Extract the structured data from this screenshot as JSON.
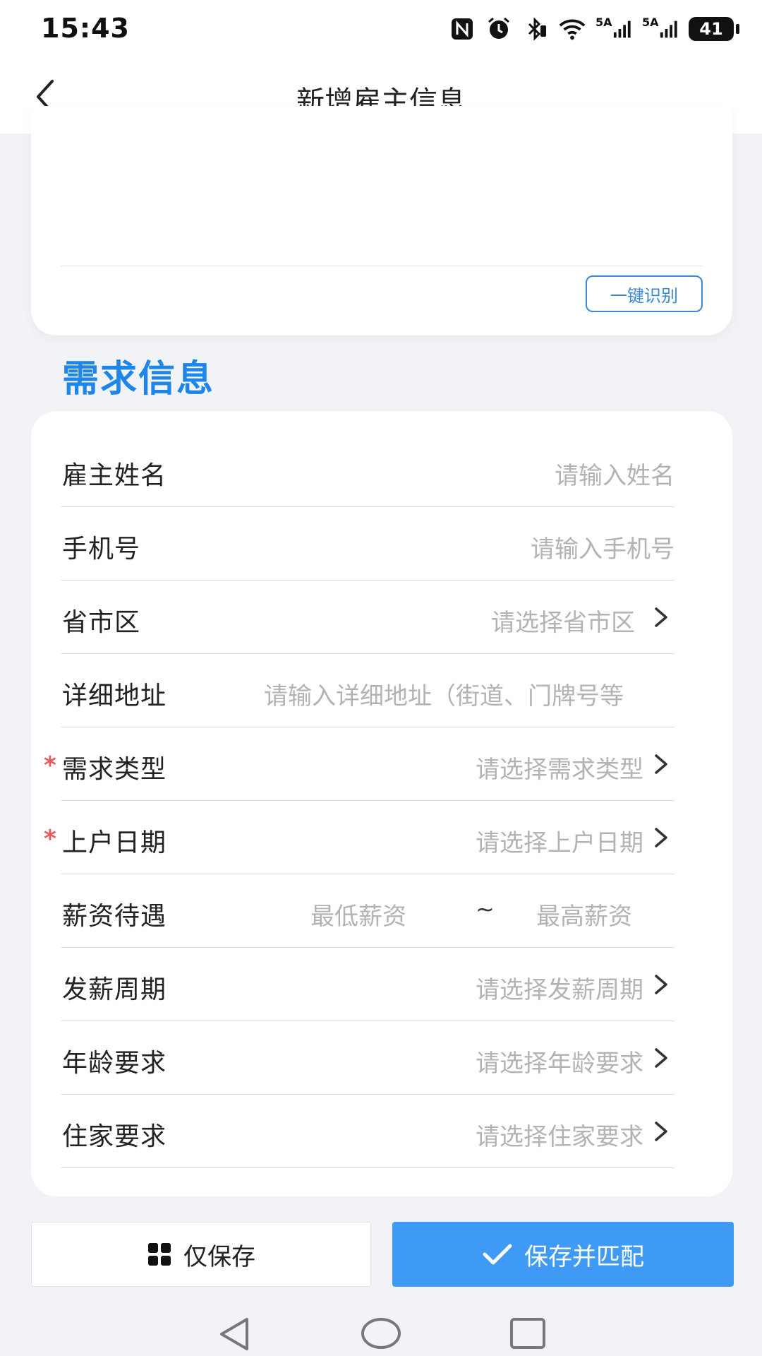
{
  "status_bar": {
    "time": "15:43",
    "network_1": "5A",
    "network_2": "5A",
    "battery": "41"
  },
  "header": {
    "title": "新增雇主信息"
  },
  "recognition": {
    "button_label": "一键识别"
  },
  "section": {
    "title": "需求信息"
  },
  "form": {
    "rows": [
      {
        "label": "雇主姓名",
        "placeholder": "请输入姓名"
      },
      {
        "label": "手机号",
        "placeholder": "请输入手机号"
      },
      {
        "label": "省市区",
        "placeholder": "请选择省市区"
      },
      {
        "label": "详细地址",
        "placeholder": "请输入详细地址（街道、门牌号等"
      },
      {
        "label": "需求类型",
        "placeholder": "请选择需求类型",
        "required_mark": "*"
      },
      {
        "label": "上户日期",
        "placeholder": "请选择上户日期",
        "required_mark": "*"
      },
      {
        "label": "薪资待遇",
        "min_placeholder": "最低薪资",
        "separator": "~",
        "max_placeholder": "最高薪资"
      },
      {
        "label": "发薪周期",
        "placeholder": "请选择发薪周期"
      },
      {
        "label": "年龄要求",
        "placeholder": "请选择年龄要求"
      },
      {
        "label": "住家要求",
        "placeholder": "请选择住家要求"
      }
    ]
  },
  "actions": {
    "save_only": "仅保存",
    "save_and_match": "保存并匹配"
  },
  "colors": {
    "accent": "#1e86e8",
    "primary_button": "#3f9af5",
    "required": "#e85a5a",
    "placeholder": "#b3b3b3"
  }
}
